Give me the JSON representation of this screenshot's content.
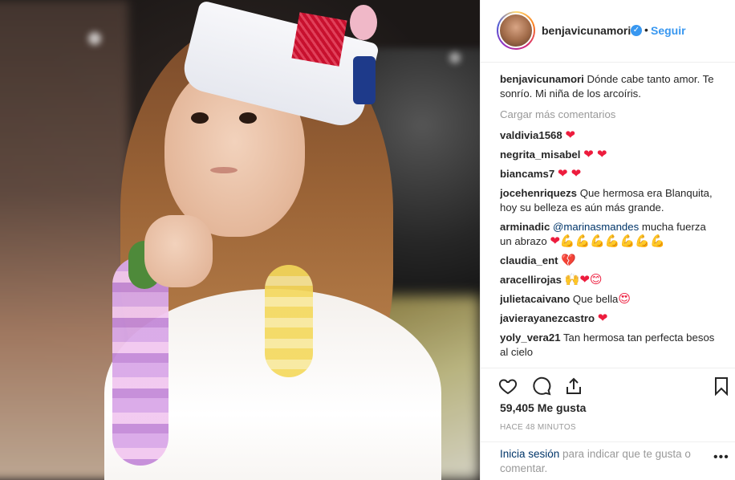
{
  "post": {
    "username": "benjavicunamori",
    "verified_mark": "✓",
    "dot": "•",
    "follow_label": "Seguir",
    "caption_user": "benjavicunamori",
    "caption_text": "Dónde cabe tanto amor. Te sonrío. Mi niña de los arcoíris."
  },
  "load_more_label": "Cargar más comentarios",
  "comments": [
    {
      "user": "valdivia1568",
      "text": "",
      "emoji": "❤"
    },
    {
      "user": "negrita_misabel",
      "text": "",
      "emoji": "❤ ❤"
    },
    {
      "user": "biancams7",
      "text": "",
      "emoji": "❤ ❤"
    },
    {
      "user": "jocehenriquezs",
      "text": "Que hermosa era Blanquita, hoy su belleza es aún más grande.",
      "emoji": ""
    },
    {
      "user": "arminadic",
      "mention": "@marinasmandes",
      "text": "mucha fuerza un abrazo",
      "emoji": "❤💪💪💪💪💪💪💪"
    },
    {
      "user": "claudia_ent",
      "text": "",
      "emoji": "💔"
    },
    {
      "user": "aracellirojas",
      "text": "",
      "emoji": "🙌❤😊"
    },
    {
      "user": "julietacaivano",
      "text": "Que bella",
      "emoji": "😍"
    },
    {
      "user": "javierayanezcastro",
      "text": "",
      "emoji": "❤"
    },
    {
      "user": "yoly_vera21",
      "text": "Tan hermosa tan perfecta besos al cielo",
      "emoji": ""
    }
  ],
  "actions": {
    "like_icon": "heart-outline-icon",
    "comment_icon": "comment-bubble-icon",
    "share_icon": "share-upload-icon",
    "save_icon": "bookmark-icon"
  },
  "likes_text": "59,405 Me gusta",
  "timestamp": "HACE 48 MINUTOS",
  "login": {
    "link": "Inicia sesión",
    "text": " para indicar que te gusta o comentar.",
    "more": "•••"
  },
  "colors": {
    "link_blue": "#3897f0",
    "mention": "#003569",
    "muted": "#999999",
    "heart": "#ed1c3d",
    "text": "#262626"
  }
}
